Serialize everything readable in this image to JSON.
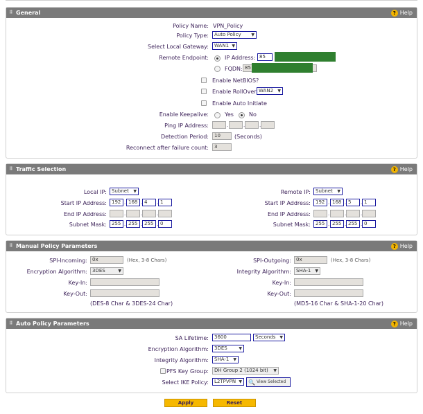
{
  "help_label": "Help",
  "general": {
    "title": "General",
    "policy_name_label": "Policy Name:",
    "policy_name_value": "VPN_Policy",
    "policy_type_label": "Policy Type:",
    "policy_type_value": "Auto Policy",
    "local_gateway_label": "Select Local Gateway:",
    "local_gateway_value": "WAN1",
    "remote_endpoint_label": "Remote Endpoint:",
    "ip_address_option": "IP Address:",
    "ip_address_value": "85",
    "fqdn_option": "FQDN:",
    "fqdn_value": "85",
    "enable_netbios": "Enable NetBIOS?",
    "enable_rollover": "Enable RollOver",
    "rollover_value": "WAN2",
    "enable_auto_initiate": "Enable Auto Initiate",
    "keepalive_label": "Enable Keepalive:",
    "keepalive_yes": "Yes",
    "keepalive_no": "No",
    "ping_ip_label": "Ping IP Address:",
    "detection_period_label": "Detection Period:",
    "detection_period_value": "10",
    "detection_period_unit": "(Seconds)",
    "reconnect_label": "Reconnect after failure count:",
    "reconnect_value": "3"
  },
  "traffic": {
    "title": "Traffic Selection",
    "local": {
      "ip_label": "Local IP:",
      "ip_type": "Subnet",
      "start_label": "Start IP Address:",
      "start": [
        "192",
        "168",
        "4",
        "1"
      ],
      "end_label": "End IP Address:",
      "mask_label": "Subnet Mask:",
      "mask": [
        "255",
        "255",
        "255",
        "0"
      ]
    },
    "remote": {
      "ip_label": "Remote IP:",
      "ip_type": "Subnet",
      "start_label": "Start IP Address:",
      "start": [
        "192",
        "168",
        "5",
        "1"
      ],
      "end_label": "End IP Address:",
      "mask_label": "Subnet Mask:",
      "mask": [
        "255",
        "255",
        "255",
        "0"
      ]
    }
  },
  "manual": {
    "title": "Manual Policy Parameters",
    "spi_in_label": "SPI-Incoming:",
    "spi_in_value": "0x",
    "spi_in_hint": "(Hex, 3-8 Chars)",
    "enc_label": "Encryption Algorithm:",
    "enc_value": "3DES",
    "key_in_label": "Key-In:",
    "key_out_label": "Key-Out:",
    "left_note": "(DES-8 Char & 3DES-24 Char)",
    "spi_out_label": "SPI-Outgoing:",
    "spi_out_value": "0x",
    "spi_out_hint": "(Hex, 3-8 Chars)",
    "int_label": "Integrity Algorithm:",
    "int_value": "SHA-1",
    "key_in_label_r": "Key-In:",
    "key_out_label_r": "Key-Out:",
    "right_note": "(MD5-16 Char & SHA-1-20 Char)"
  },
  "auto": {
    "title": "Auto Policy Parameters",
    "sa_label": "SA Lifetime:",
    "sa_value": "3600",
    "sa_unit": "Seconds",
    "enc_label": "Encryption Algorithm:",
    "enc_value": "3DES",
    "int_label": "Integrity Algorithm:",
    "int_value": "SHA-1",
    "pfs_label": "PFS Key Group:",
    "pfs_value": "DH Group 2 (1024 bit)",
    "ike_label": "Select IKE Policy:",
    "ike_value": "L2TPVPN",
    "view_selected": "View Selected"
  },
  "buttons": {
    "apply": "Apply",
    "reset": "Reset"
  },
  "colors": {
    "header": "#7a7a7a",
    "button": "#f6b800",
    "text": "#3a1f57",
    "redaction": "#2f7f2f"
  }
}
